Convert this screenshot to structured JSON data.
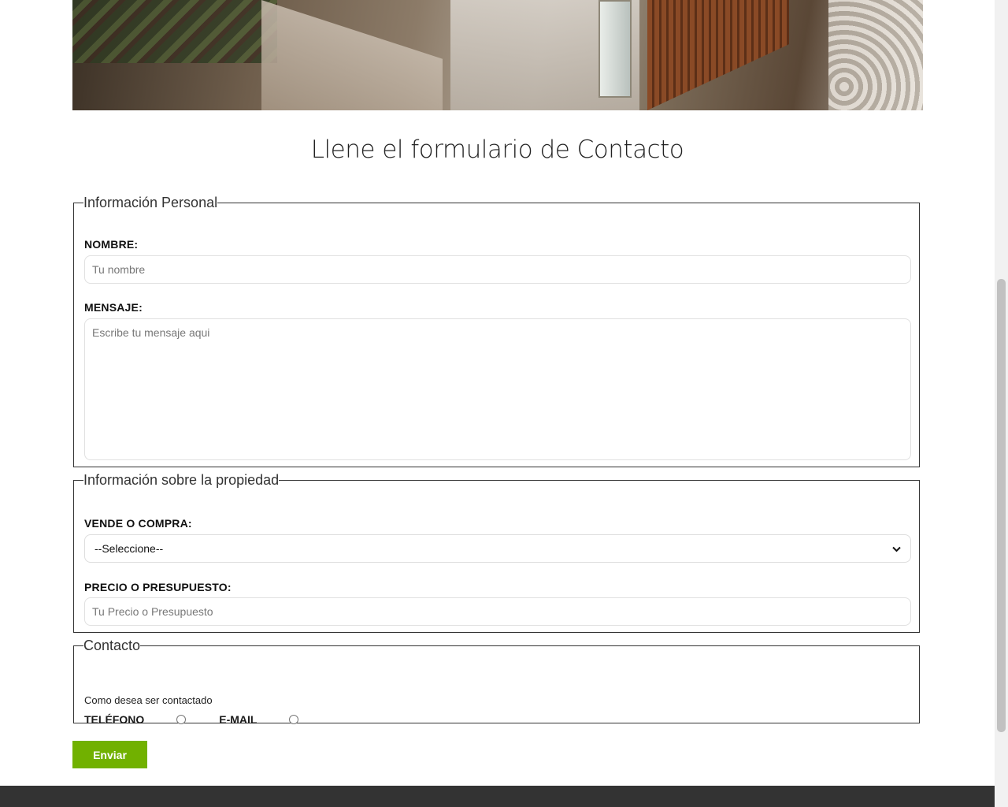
{
  "form": {
    "title": "Llene el formulario de Contacto",
    "personal": {
      "legend": "Información Personal",
      "name_label": "NOMBRE:",
      "name_placeholder": "Tu nombre",
      "message_label": "MENSAJE:",
      "message_placeholder": "Escribe tu mensaje aqui"
    },
    "property": {
      "legend": "Información sobre la propiedad",
      "type_label": "VENDE O COMPRA:",
      "type_selected": "--Seleccione--",
      "price_label": "PRECIO O PRESUPUESTO:",
      "price_placeholder": "Tu Precio o Presupuesto"
    },
    "contact": {
      "legend": "Contacto",
      "hint": "Como desea ser contactado",
      "phone_label": "TELÉFONO",
      "email_label": "E-MAIL"
    },
    "submit_label": "Enviar"
  },
  "colors": {
    "accent": "#71b100",
    "footer": "#333333"
  },
  "icons": {
    "select_chevron": "chevron-down-icon"
  }
}
